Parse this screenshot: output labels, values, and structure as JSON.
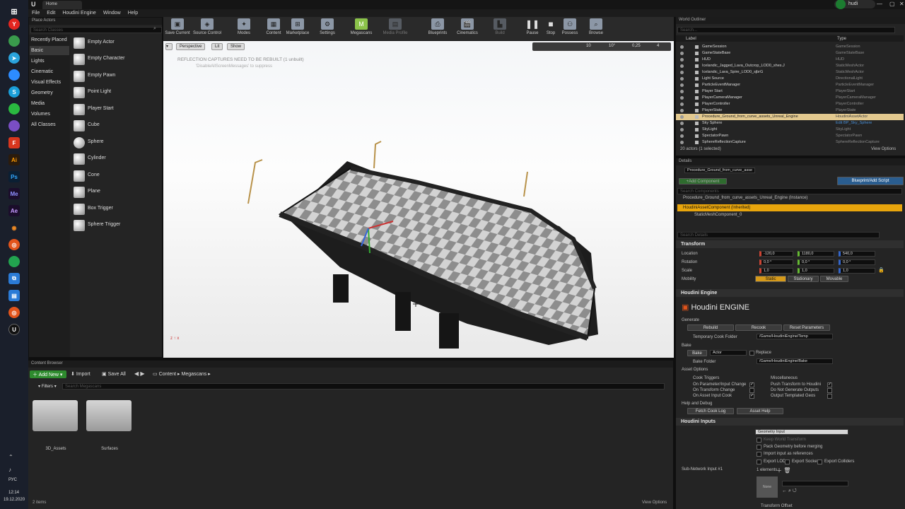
{
  "window": {
    "tab_title": "Home",
    "user": "hudi"
  },
  "menu": [
    "File",
    "Edit",
    "Houdini Engine",
    "Window",
    "Help"
  ],
  "place_actors": {
    "tab": "Place Actors",
    "search_placeholder": "Search Classes",
    "categories": [
      "Recently Placed",
      "Basic",
      "Lights",
      "Cinematic",
      "Visual Effects",
      "Geometry",
      "Media",
      "Volumes",
      "All Classes"
    ],
    "items": [
      "Empty Actor",
      "Empty Character",
      "Empty Pawn",
      "Point Light",
      "Player Start",
      "Cube",
      "Sphere",
      "Cylinder",
      "Cone",
      "Plane",
      "Box Trigger",
      "Sphere Trigger"
    ]
  },
  "toolbar": [
    "Save Current",
    "Source Control",
    "Modes",
    "Content",
    "Marketplace",
    "Settings",
    "Megascans",
    "Media Profile",
    "Blueprints",
    "Cinematics",
    "Build",
    "Pause",
    "Stop",
    "Possess",
    "Browse"
  ],
  "viewport": {
    "perspective": "Perspective",
    "lit": "Lit",
    "show": "Show",
    "warning": "REFLECTION CAPTURES NEED TO BE REBUILT (1 unbuilt)",
    "warning_sub": "'DisableAllScreenMessages' to suppress",
    "snap_grid": "10",
    "snap_rot": "10°",
    "snap_scale": "0,25",
    "cam_speed": "4"
  },
  "content_browser": {
    "tab": "Content Browser",
    "add_new": "Add New",
    "import": "Import",
    "save_all": "Save All",
    "path": [
      "Content",
      "Megascans"
    ],
    "filters": "Filters",
    "search_placeholder": "Search Megascans",
    "folders": [
      "3D_Assets",
      "Surfaces"
    ],
    "item_count": "2 items",
    "view_options": "View Options"
  },
  "outliner": {
    "tab": "World Outliner",
    "search_placeholder": "Search...",
    "col_label": "Label",
    "col_type": "Type",
    "rows": [
      {
        "name": "GameSession",
        "type": "GameSession"
      },
      {
        "name": "GameStateBase",
        "type": "GameStateBase"
      },
      {
        "name": "HUD",
        "type": "HUD"
      },
      {
        "name": "Icelandic_Jagged_Lava_Outcrop_LOD0_shes.J",
        "type": "StaticMeshActor"
      },
      {
        "name": "Icelandic_Lava_Spire_LOD0_sjbrG",
        "type": "StaticMeshActor"
      },
      {
        "name": "Light Source",
        "type": "DirectionalLight"
      },
      {
        "name": "ParticleEventManager",
        "type": "ParticleEventManager"
      },
      {
        "name": "Player Start",
        "type": "PlayerStart"
      },
      {
        "name": "PlayerCameraManager",
        "type": "PlayerCameraManager"
      },
      {
        "name": "PlayerController",
        "type": "PlayerController"
      },
      {
        "name": "PlayerState",
        "type": "PlayerState"
      },
      {
        "name": "Procedure_Ground_from_curve_assets_Unreal_Engine",
        "type": "HoudiniAssetActor"
      },
      {
        "name": "Sky Sphere",
        "type": "Edit BP_Sky_Sphere"
      },
      {
        "name": "SkyLight",
        "type": "SkyLight"
      },
      {
        "name": "SpectatorPawn",
        "type": "SpectatorPawn"
      },
      {
        "name": "SphereReflectionCapture",
        "type": "SphereReflectionCapture"
      }
    ],
    "status": "20 actors (1 selected)",
    "view_options": "View Options"
  },
  "details": {
    "tab": "Details",
    "actor_name": "Procedure_Ground_from_curve_asse",
    "add_component": "+Add Component",
    "blueprint": "Blueprint/Add Script",
    "search_components": "Search Components",
    "instance": "Procedure_Ground_from_curve_assets_Unreal_Engine (Instance)",
    "comp1": "HoudiniAssetComponent (Inherited)",
    "comp2": "StaticMeshComponent_0",
    "search_details": "Search Details",
    "transform": "Transform",
    "location": {
      "label": "Location",
      "x": "-120,0",
      "y": "1180,0",
      "z": "540,0"
    },
    "rotation": {
      "label": "Rotation",
      "x": "0,0 °",
      "y": "0,0 °",
      "z": "0,0 °"
    },
    "scale": {
      "label": "Scale",
      "x": "1,0",
      "y": "1,0",
      "z": "1,0"
    },
    "mobility": {
      "label": "Mobility",
      "opts": [
        "Static",
        "Stationary",
        "Movable"
      ]
    },
    "houdini_engine": "Houdini Engine",
    "houdini_logo": "Houdini ENGINE",
    "generate": "Generate",
    "rebuild": "Rebuild",
    "recook": "Recook",
    "reset_params": "Reset Parameters",
    "temp_folder_label": "Temporary Cook Folder",
    "temp_folder": "/Game/HoudiniEngine/Temp",
    "bake": "Bake",
    "bake_btn": "Bake",
    "bake_target": "Actor",
    "replace": "Replace",
    "bake_folder_label": "Bake Folder",
    "bake_folder": "/Game/HoudiniEngine/Bake",
    "asset_options": "Asset Options",
    "cook_triggers": "Cook Triggers",
    "misc": "Miscellaneous",
    "opt_left": [
      "On Parameter/Input Change",
      "On Transform Change",
      "On Asset Input Cook"
    ],
    "opt_right": [
      "Push Transform to Houdini",
      "Do Not Generate Outputs",
      "Output Templated Geos"
    ],
    "help_debug": "Help and Debug",
    "fetch_log": "Fetch Cook Log",
    "asset_help": "Asset Help",
    "inputs": "Houdini Inputs",
    "geo_input": "Geometry Input",
    "keep_world": "Keep World Transform",
    "pack_geo": "Pack Geometry before merging",
    "import_refs": "Import input as references",
    "export_lods": "Export LODs",
    "export_sockets": "Export Sockets",
    "export_colliders": "Export Colliders",
    "subnet": "Sub-Network Input #1",
    "elements": "1 elements",
    "none": "None",
    "transform_offset": "Transform Offset"
  },
  "clock": {
    "lang": "РУС",
    "time": "12:14",
    "date": "19.12.2020"
  }
}
